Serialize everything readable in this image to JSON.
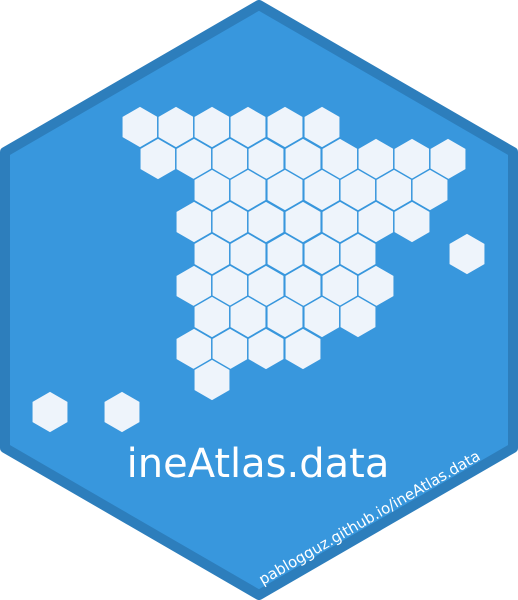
{
  "sticker": {
    "title": "ineAtlas.data",
    "url": "pablogguz.github.io/ineAtlas.data",
    "colors": {
      "fill": "#3897dd",
      "border": "#2d7ebc",
      "hex_tile": "#eef4fb",
      "text": "#ffffff"
    }
  }
}
